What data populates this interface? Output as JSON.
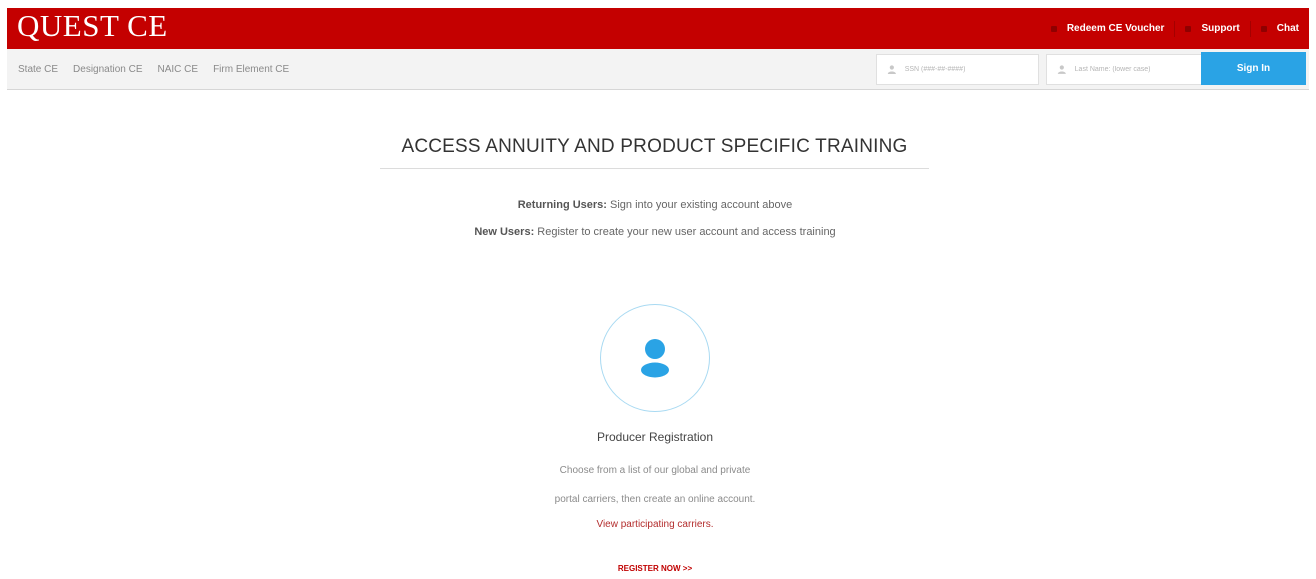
{
  "header": {
    "logo": "QUEST CE",
    "links": [
      {
        "label": "Redeem CE Voucher",
        "icon": "voucher-icon"
      },
      {
        "label": "Support",
        "icon": "support-icon"
      },
      {
        "label": "Chat",
        "icon": "chat-icon"
      }
    ]
  },
  "nav": {
    "items": [
      "State CE",
      "Designation CE",
      "NAIC CE",
      "Firm Element CE"
    ],
    "ssn_placeholder": "SSN (###-##-####)",
    "lastname_placeholder": "Last Name: (lower case)",
    "signin_label": "Sign In"
  },
  "main": {
    "title": "ACCESS ANNUITY AND PRODUCT SPECIFIC TRAINING",
    "returning_label": "Returning Users:",
    "returning_text": "Sign into your existing account above",
    "new_label": "New Users:",
    "new_text": "Register to create your new user account and access training",
    "registration_title": "Producer Registration",
    "desc_line1": "Choose from a list of our global and private",
    "desc_line2": "portal carriers, then create an online account.",
    "carriers_link": "View participating carriers.",
    "register_link": "REGISTER NOW >>"
  },
  "colors": {
    "brand_red": "#c40000",
    "signin_blue": "#2aa3e5",
    "avatar_blue": "#2aa3e5"
  }
}
